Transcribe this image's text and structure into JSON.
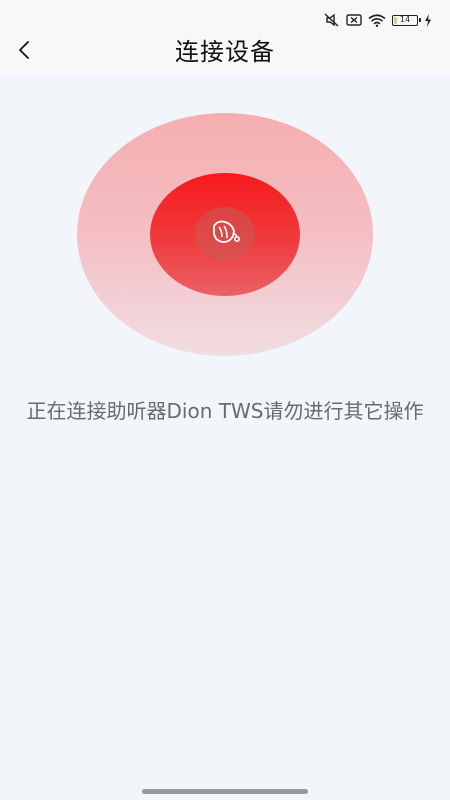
{
  "status_bar": {
    "battery_level": "14",
    "battery_fraction": 0.14,
    "icons": [
      "mute-icon",
      "sim-off-icon",
      "wifi-icon",
      "battery-icon",
      "charging-icon"
    ]
  },
  "header": {
    "title": "连接设备",
    "back_icon": "chevron-left-icon"
  },
  "connecting": {
    "device_icon": "hearing-aid-icon",
    "message": "正在连接助听器Dion TWS请勿进行其它操作"
  },
  "colors": {
    "background": "#f2f5f9",
    "pulse_inner": "#f61a1d",
    "pulse_outer": "#f5aeb0",
    "message_text": "#6b6b6b"
  }
}
